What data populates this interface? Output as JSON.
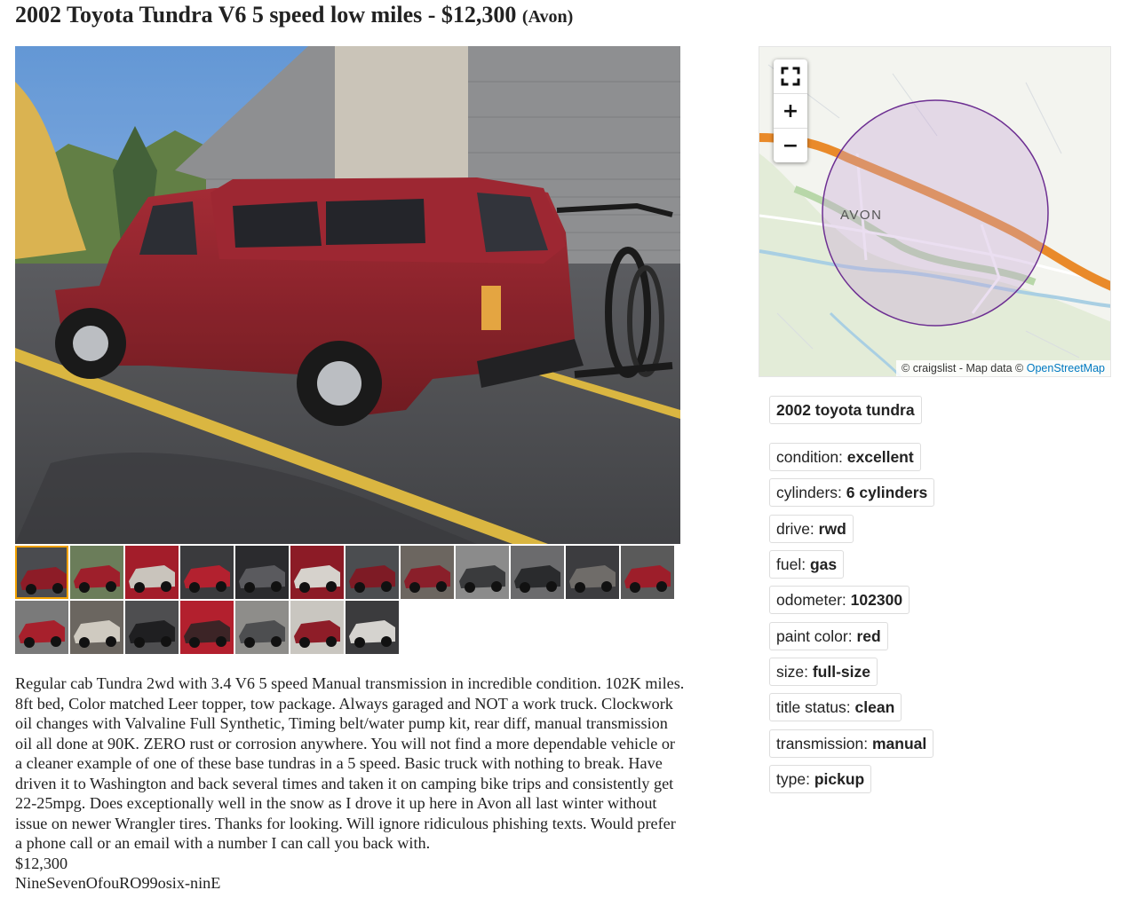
{
  "posting": {
    "title": "2002 Toyota Tundra V6 5 speed low miles - $12,300",
    "location": "(Avon)"
  },
  "gallery": {
    "thumbnail_count": 19,
    "selected_index": 0
  },
  "map": {
    "place_label": "AVON",
    "attribution_prefix": "© craigslist - Map data ©",
    "attribution_link": "OpenStreetMap",
    "controls": {
      "fullscreen_icon": "fullscreen-icon",
      "zoom_in": "+",
      "zoom_out": "−"
    },
    "colors": {
      "highway": "#f0922c",
      "radius": "#7a3f9e"
    }
  },
  "attributes": {
    "heading": "2002 toyota tundra",
    "items": [
      {
        "label": "condition:",
        "value": "excellent"
      },
      {
        "label": "cylinders:",
        "value": "6 cylinders"
      },
      {
        "label": "drive:",
        "value": "rwd"
      },
      {
        "label": "fuel:",
        "value": "gas"
      },
      {
        "label": "odometer:",
        "value": "102300"
      },
      {
        "label": "paint color:",
        "value": "red"
      },
      {
        "label": "size:",
        "value": "full-size"
      },
      {
        "label": "title status:",
        "value": "clean"
      },
      {
        "label": "transmission:",
        "value": "manual"
      },
      {
        "label": "type:",
        "value": "pickup"
      }
    ]
  },
  "description": {
    "lines": [
      "Regular cab Tundra 2wd with 3.4 V6 5 speed Manual transmission in incredible condition. 102K miles.",
      "8ft bed, Color matched Leer topper, tow package. Always garaged and NOT a work truck. Clockwork",
      "oil changes with Valvaline Full Synthetic, Timing belt/water pump kit, rear diff, manual transmission",
      "oil all done at 90K. ZERO rust or corrosion anywhere. You will not find a more dependable vehicle or",
      "a cleaner example of one of these base tundras in a 5 speed. Basic truck with nothing to break. Have",
      "driven it to Washington and back several times and taken it on camping bike trips and consistently get",
      "22-25mpg. Does exceptionally well in the snow as I drove it up here in Avon all last winter without",
      "issue on newer Wrangler tires. Thanks for looking. Will ignore ridiculous phishing texts. Would prefer",
      "a phone call or an email with a number I can call you back with."
    ],
    "price": "$12,300",
    "contact": "NineSevenOfouRO99osix-ninE"
  }
}
